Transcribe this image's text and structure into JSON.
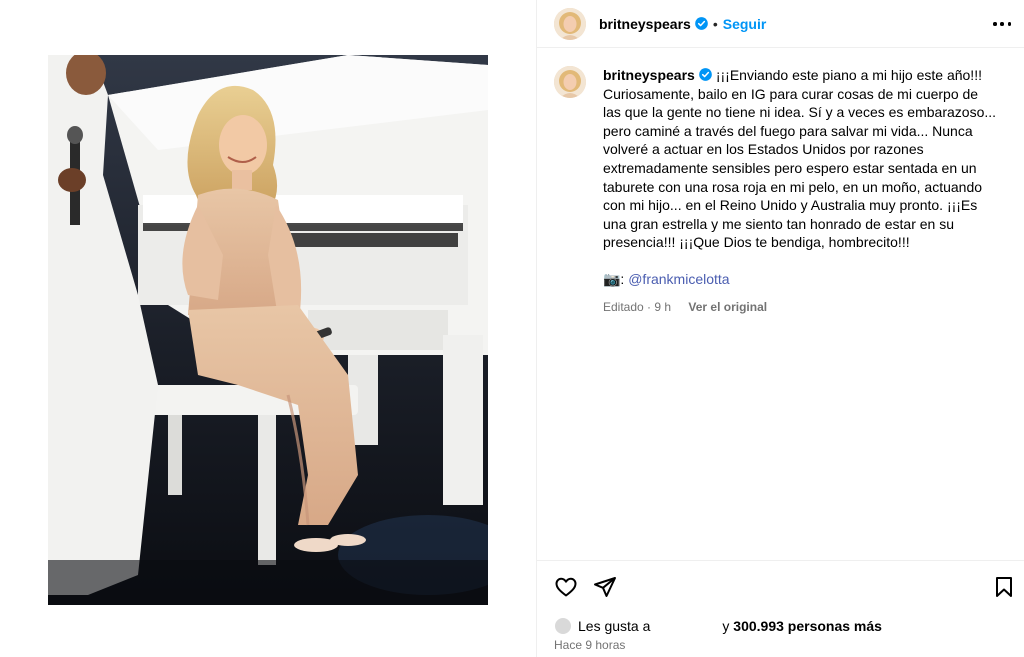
{
  "post": {
    "username": "britneyspears",
    "follow_label": "Seguir",
    "dot": "•"
  },
  "caption": {
    "username": "britneyspears",
    "text": "¡¡¡Enviando este piano a mi hijo este año!!! Curiosamente, bailo en IG para curar cosas de mi cuerpo de las que la gente no tiene ni idea. Sí y a veces es embarazoso... pero caminé a través del fuego para salvar mi vida... Nunca volveré a actuar en los Estados Unidos por razones extremadamente sensibles pero espero estar sentada en un taburete con una rosa roja en mi pelo, en un moño, actuando con mi hijo... en el Reino Unido y Australia muy pronto. ¡¡¡Es una gran estrella y me siento tan honrado de estar en su presencia!!! ¡¡¡Que Dios te bendiga, hombrecito!!!",
    "camera_glyph": "📷:",
    "mention": "@frankmicelotta",
    "edited": "Editado · 9 h",
    "see_original": "Ver el original"
  },
  "likes": {
    "prefix": "Les gusta a",
    "connector": "y",
    "count_text": "300.993 personas más"
  },
  "timestamp": "Hace 9 horas",
  "icons": {
    "verified": "verified-badge-icon",
    "more": "more-options-icon",
    "like": "heart-icon",
    "share": "paper-plane-icon",
    "save": "bookmark-icon"
  },
  "colors": {
    "accent": "#0095f6",
    "verified": "#0095f6",
    "muted": "#737373",
    "border": "#efefef"
  }
}
